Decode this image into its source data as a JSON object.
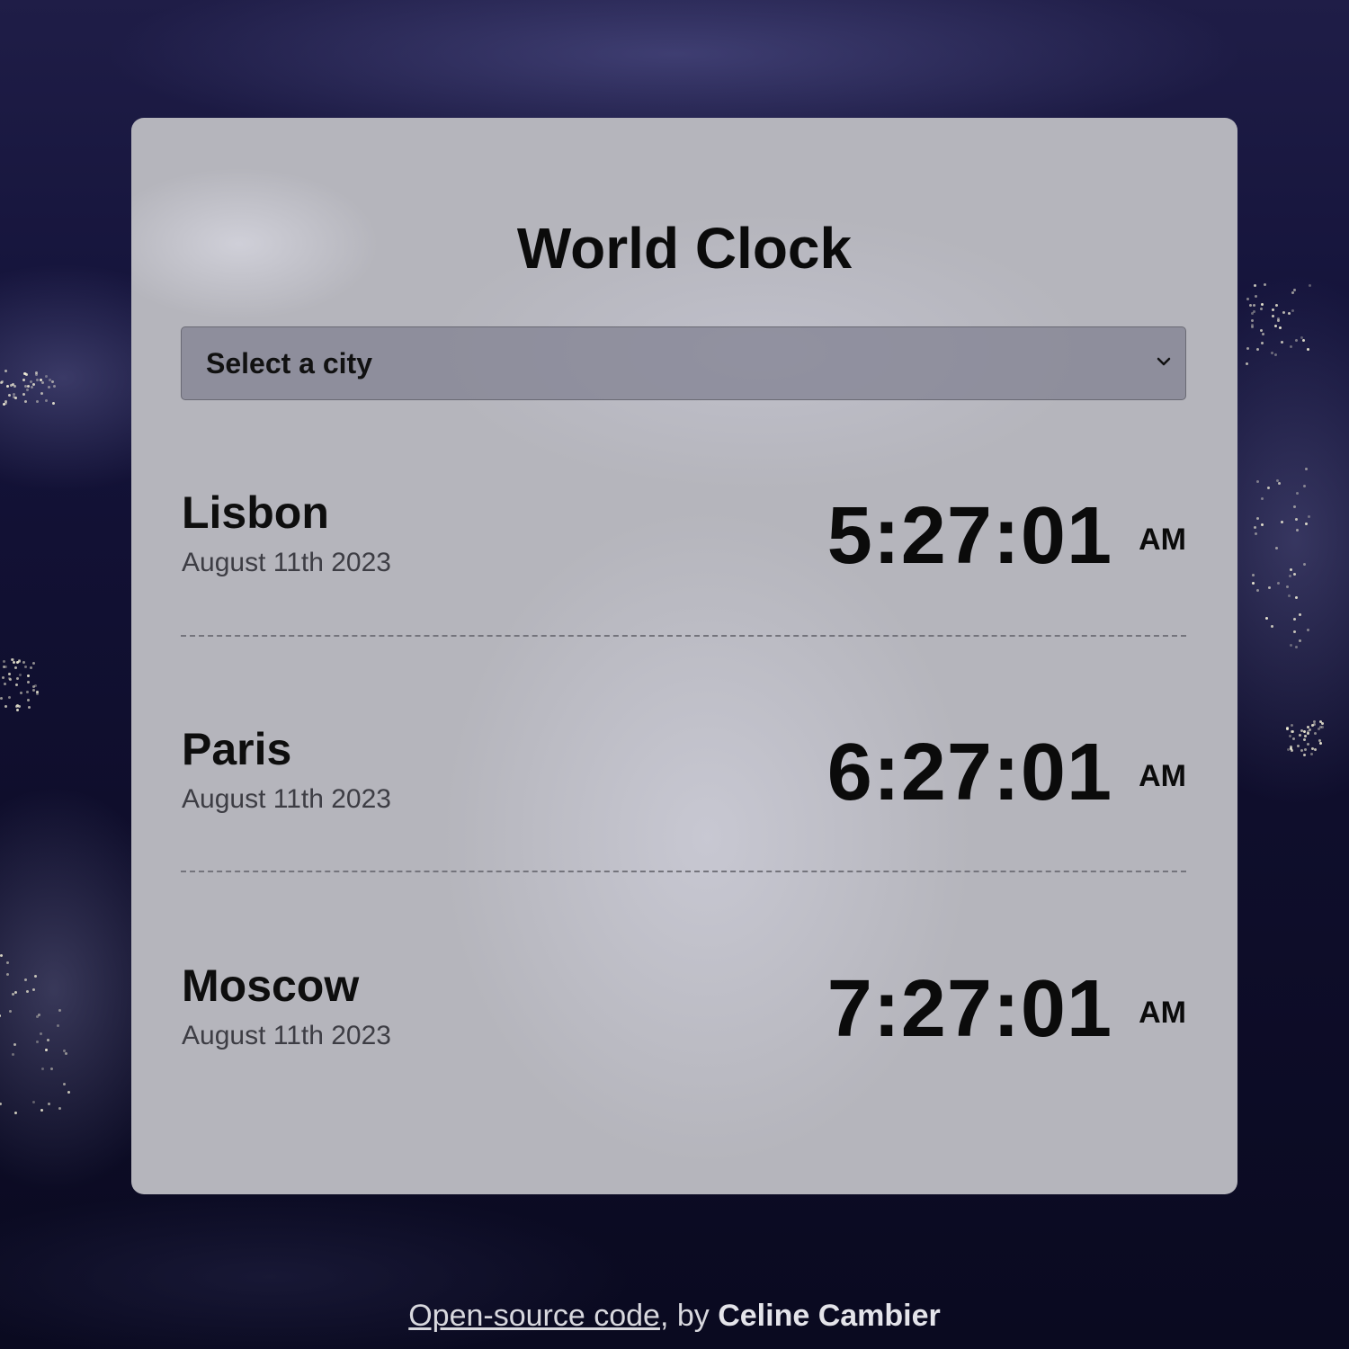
{
  "header": {
    "title": "World Clock"
  },
  "city_select": {
    "selected_label": "Select a city"
  },
  "cities": [
    {
      "name": "Lisbon",
      "date": "August 11th 2023",
      "time": "5:27:01",
      "ampm": "AM"
    },
    {
      "name": "Paris",
      "date": "August 11th 2023",
      "time": "6:27:01",
      "ampm": "AM"
    },
    {
      "name": "Moscow",
      "date": "August 11th 2023",
      "time": "7:27:01",
      "ampm": "AM"
    }
  ],
  "footer": {
    "link_text": "Open-source code",
    "by_text": ", by ",
    "author": "Celine Cambier"
  },
  "colors": {
    "background": "#0d0c24",
    "card": "#b5b5bc",
    "text": "#0b0b0b"
  }
}
